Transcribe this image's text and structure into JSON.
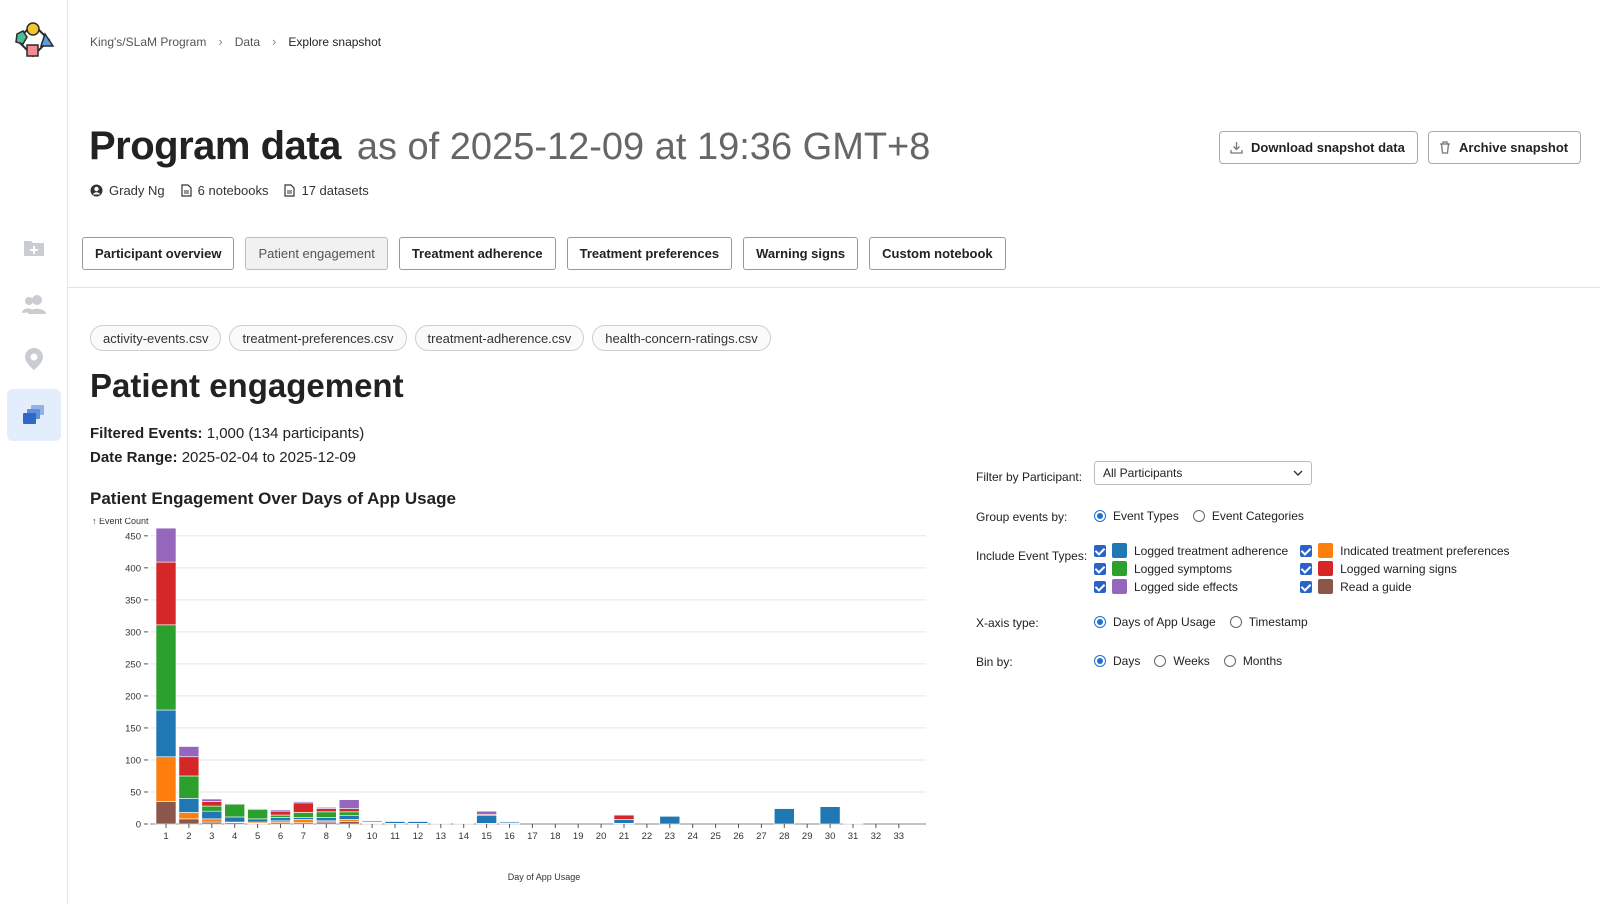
{
  "breadcrumb": [
    "King's/SLaM Program",
    "Data",
    "Explore snapshot"
  ],
  "header": {
    "title": "Program data",
    "subtitle": "as of 2025-12-09 at 19:36 GMT+8",
    "owner": "Grady Ng",
    "notebooks": "6 notebooks",
    "datasets": "17 datasets",
    "download_label": "Download snapshot data",
    "archive_label": "Archive snapshot"
  },
  "tabs": [
    {
      "label": "Participant overview",
      "active": false
    },
    {
      "label": "Patient engagement",
      "active": true
    },
    {
      "label": "Treatment adherence",
      "active": false
    },
    {
      "label": "Treatment preferences",
      "active": false
    },
    {
      "label": "Warning signs",
      "active": false
    },
    {
      "label": "Custom notebook",
      "active": false
    }
  ],
  "files": [
    "activity-events.csv",
    "treatment-preferences.csv",
    "treatment-adherence.csv",
    "health-concern-ratings.csv"
  ],
  "page": {
    "title": "Patient engagement",
    "filtered_label": "Filtered Events:",
    "filtered_value": "1,000 (134 participants)",
    "range_label": "Date Range:",
    "range_value": "2025-02-04 to 2025-12-09"
  },
  "controls": {
    "participant_label": "Filter by Participant:",
    "participant_value": "All Participants",
    "group_label": "Group events by:",
    "group_options": [
      "Event Types",
      "Event Categories"
    ],
    "group_selected": 0,
    "types_label": "Include Event Types:",
    "event_types": [
      {
        "label": "Logged treatment adherence",
        "color": "#1f77b4",
        "checked": true
      },
      {
        "label": "Indicated treatment preferences",
        "color": "#ff7f0e",
        "checked": true
      },
      {
        "label": "Logged symptoms",
        "color": "#2ca02c",
        "checked": true
      },
      {
        "label": "Logged warning signs",
        "color": "#d62728",
        "checked": true
      },
      {
        "label": "Logged side effects",
        "color": "#9467bd",
        "checked": true
      },
      {
        "label": "Read a guide",
        "color": "#8c564b",
        "checked": true
      }
    ],
    "xaxis_label": "X-axis type:",
    "xaxis_options": [
      "Days of App Usage",
      "Timestamp"
    ],
    "xaxis_selected": 0,
    "bin_label": "Bin by:",
    "bin_options": [
      "Days",
      "Weeks",
      "Months"
    ],
    "bin_selected": 0
  },
  "chart_data": {
    "type": "bar",
    "stacked": true,
    "title": "Patient Engagement Over Days of App Usage",
    "xlabel": "Day of App Usage",
    "ylabel": "↑ Event Count",
    "ylim": [
      0,
      470
    ],
    "yticks": [
      0,
      50,
      100,
      150,
      200,
      250,
      300,
      350,
      400,
      450
    ],
    "grid": "horizontal",
    "categories": [
      "1",
      "2",
      "3",
      "4",
      "5",
      "6",
      "7",
      "8",
      "9",
      "10",
      "11",
      "12",
      "13",
      "14",
      "15",
      "16",
      "17",
      "18",
      "19",
      "20",
      "21",
      "22",
      "23",
      "24",
      "25",
      "26",
      "27",
      "28",
      "29",
      "30",
      "31",
      "32",
      "33"
    ],
    "series": [
      {
        "name": "Read a guide",
        "color": "#8c564b",
        "values": [
          35,
          8,
          3,
          2,
          1,
          2,
          2,
          3,
          4,
          1,
          1,
          1,
          0,
          0,
          1,
          1,
          0,
          0,
          0,
          0,
          1,
          0,
          0,
          0,
          0,
          0,
          0,
          0,
          0,
          0,
          0,
          0,
          0
        ]
      },
      {
        "name": "Indicated treatment preferences",
        "color": "#ff7f0e",
        "values": [
          70,
          10,
          5,
          1,
          2,
          3,
          5,
          2,
          3,
          1,
          0,
          0,
          0,
          0,
          0,
          0,
          0,
          0,
          0,
          0,
          0,
          0,
          0,
          0,
          0,
          0,
          0,
          0,
          0,
          0,
          0,
          0,
          0
        ]
      },
      {
        "name": "Logged treatment adherence",
        "color": "#1f77b4",
        "values": [
          73,
          22,
          12,
          8,
          5,
          5,
          3,
          5,
          6,
          1,
          3,
          3,
          1,
          1,
          12,
          2,
          0,
          0,
          0,
          0,
          6,
          0,
          12,
          0,
          0,
          0,
          0,
          24,
          0,
          27,
          1,
          0,
          0
        ]
      },
      {
        "name": "Logged symptoms",
        "color": "#2ca02c",
        "values": [
          133,
          35,
          8,
          20,
          15,
          4,
          8,
          9,
          6,
          2,
          0,
          1,
          0,
          0,
          0,
          0,
          0,
          0,
          0,
          0,
          0,
          0,
          0,
          0,
          0,
          0,
          0,
          0,
          0,
          0,
          0,
          0,
          0
        ]
      },
      {
        "name": "Logged warning signs",
        "color": "#d62728",
        "values": [
          98,
          30,
          7,
          1,
          1,
          6,
          15,
          5,
          5,
          0,
          1,
          1,
          0,
          0,
          2,
          1,
          0,
          0,
          0,
          0,
          7,
          0,
          0,
          0,
          0,
          0,
          0,
          0,
          0,
          0,
          0,
          0,
          0
        ]
      },
      {
        "name": "Logged side effects",
        "color": "#9467bd",
        "values": [
          53,
          16,
          4,
          1,
          1,
          2,
          2,
          2,
          14,
          1,
          1,
          1,
          0,
          0,
          5,
          1,
          0,
          0,
          0,
          0,
          1,
          0,
          0,
          0,
          0,
          0,
          0,
          0,
          0,
          0,
          0,
          0,
          0
        ]
      }
    ]
  }
}
